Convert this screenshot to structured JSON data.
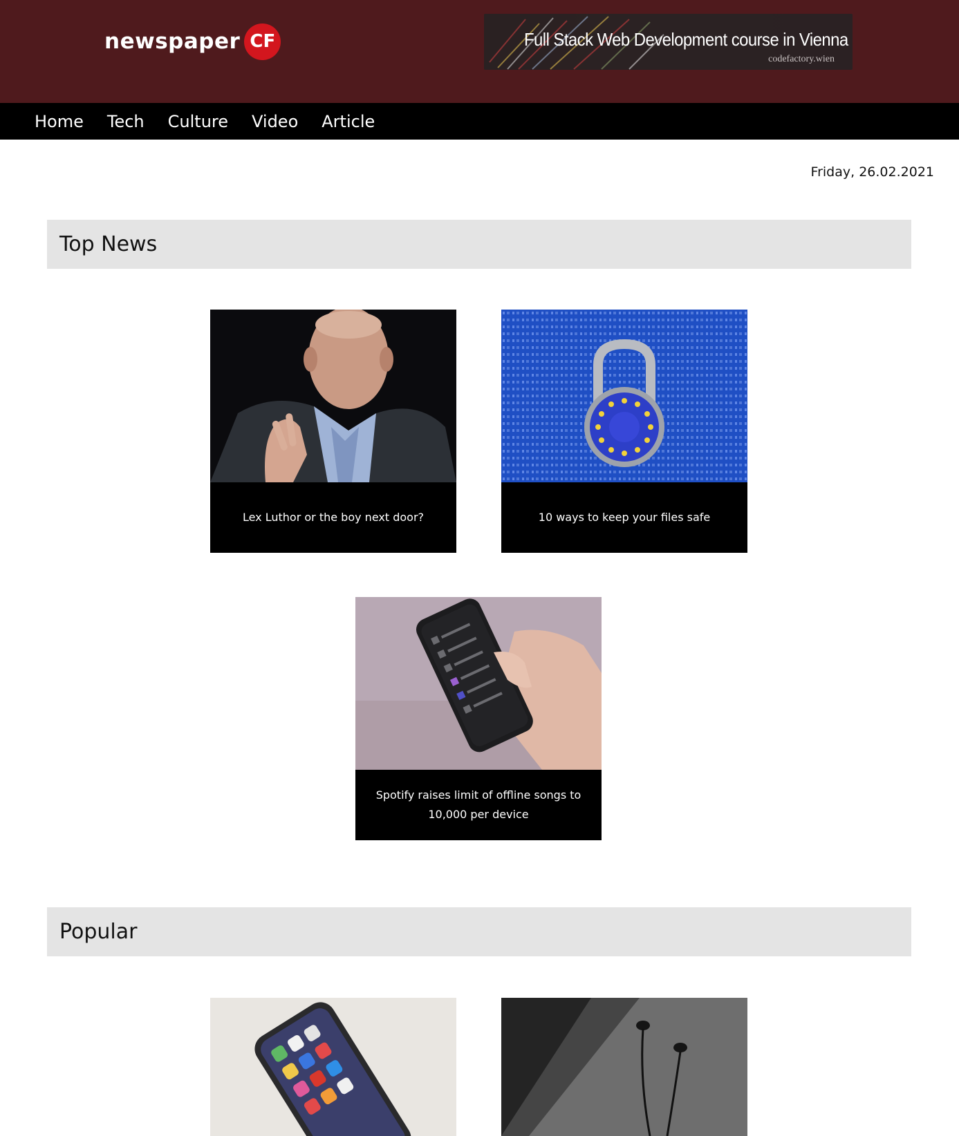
{
  "header": {
    "logo_text": "newspaper",
    "logo_badge": "CF",
    "ad": {
      "title": "Full Stack Web Development course in Vienna",
      "subtitle": "codefactory.wien"
    }
  },
  "nav": {
    "items": [
      {
        "label": "Home"
      },
      {
        "label": "Tech"
      },
      {
        "label": "Culture"
      },
      {
        "label": "Video"
      },
      {
        "label": "Article"
      }
    ]
  },
  "date": "Friday, 26.02.2021",
  "sections": [
    {
      "title": "Top News",
      "articles": [
        {
          "caption": "Lex Luthor or the boy next door?",
          "image": "businessman-photo"
        },
        {
          "caption": "10 ways to keep your files safe",
          "image": "eu-padlock-photo"
        },
        {
          "caption": "Spotify raises limit of offline songs to 10,000 per device",
          "image": "phone-in-hand-photo"
        }
      ]
    },
    {
      "title": "Popular",
      "articles": [
        {
          "caption": "",
          "image": "iphone-photo"
        },
        {
          "caption": "",
          "image": "earphones-photo"
        }
      ]
    }
  ],
  "colors": {
    "masthead": "#4f1a1d",
    "nav": "#000000",
    "logo_badge": "#d3161e",
    "section_header": "#e4e4e4"
  }
}
